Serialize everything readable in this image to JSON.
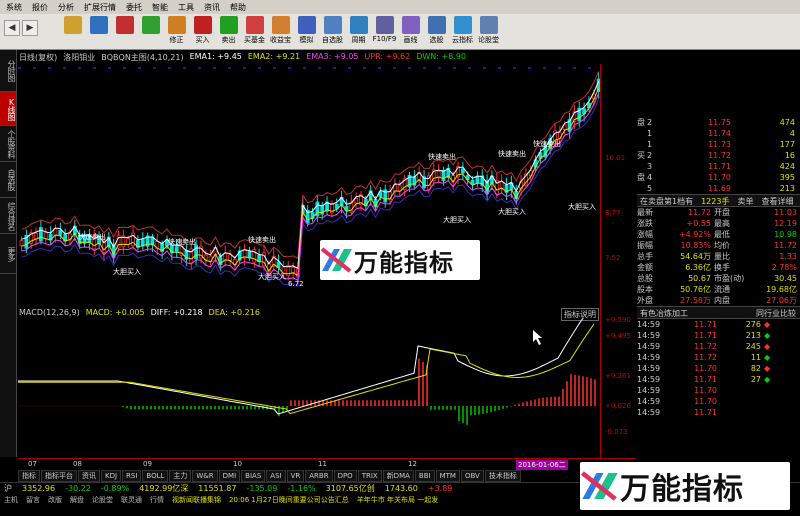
{
  "menu": [
    "系统",
    "报价",
    "分析",
    "扩展行情",
    "委托",
    "智能",
    "工具",
    "资讯",
    "帮助"
  ],
  "toolbar": [
    "",
    "",
    "",
    "",
    "修正",
    "买入",
    "卖出",
    "买基金",
    "收益宝",
    "模拟",
    "自选股",
    "周期",
    "F10/F9",
    "画线",
    "选股",
    "云指标",
    "论股堂"
  ],
  "left_tabs": [
    "分时图",
    "K线图",
    "个股资料",
    "自选股",
    "综合排名",
    "更多"
  ],
  "info": {
    "period": "日线(复权)",
    "stock": "洛阳钼业",
    "indicator": "BQBQN主图(4,10,21)",
    "ema1": "EMA1: +9.45",
    "ema2": "EMA2: +9.21",
    "ema3": "EMA3: +9.05",
    "upr": "UPR: +9.62",
    "dwn": "DWN: +8.90"
  },
  "macd": {
    "title": "MACD(12,26,9)",
    "macd": "MACD: +0.005",
    "diff": "DIFF: +0.218",
    "dea": "DEA: +0.216",
    "right": "指标说明"
  },
  "axis_right": [
    "10.01",
    "8.77",
    "7.52",
    "+0.590",
    "+0.495",
    "+0.261",
    "+0.026",
    "-0.073"
  ],
  "xaxis": [
    "07",
    "08",
    "09",
    "10",
    "11",
    "12",
    "2016-01-06二"
  ],
  "bottom_tabs": [
    "指标",
    "指标平台",
    "资讯",
    "KDJ",
    "RSI",
    "BOLL",
    "主力",
    "W&R",
    "DMI",
    "BIAS",
    "ASI",
    "VR",
    "ARBR",
    "DPO",
    "TRIX",
    "新DMA",
    "BBI",
    "MTM",
    "OBV",
    "技术指标"
  ],
  "annotations": [
    {
      "t": "快速卖出",
      "c": "wht"
    },
    {
      "t": "快速卖出",
      "c": "wht"
    },
    {
      "t": "快速卖出",
      "c": "wht"
    },
    {
      "t": "快速卖出",
      "c": "wht"
    },
    {
      "t": "快速卖出",
      "c": "wht"
    },
    {
      "t": "快速卖出",
      "c": "wht"
    },
    {
      "t": "大胆买入",
      "c": "wht"
    },
    {
      "t": "大胆买入",
      "c": "wht"
    },
    {
      "t": "大胆买入",
      "c": "wht"
    },
    {
      "t": "大胆买入",
      "c": "wht"
    },
    {
      "t": "大胆买入",
      "c": "wht"
    },
    {
      "t": "6.72",
      "c": "wht"
    }
  ],
  "orderbook": [
    {
      "l": "盘",
      "n": "2",
      "p": "11.75",
      "v": "474"
    },
    {
      "l": "",
      "n": "1",
      "p": "11.74",
      "v": "4"
    },
    {
      "l": "",
      "n": "1",
      "p": "11.73",
      "v": "177"
    },
    {
      "l": "买",
      "n": "2",
      "p": "11.72",
      "v": "16"
    },
    {
      "l": "",
      "n": "3",
      "p": "11.71",
      "v": "424"
    },
    {
      "l": "盘",
      "n": "4",
      "p": "11.70",
      "v": "395"
    },
    {
      "l": "",
      "n": "5",
      "p": "11.69",
      "v": "213"
    }
  ],
  "tabs_line": [
    "在卖盘第1档有",
    "1223手",
    "卖单",
    "查看详细"
  ],
  "quote": [
    {
      "a": "最新",
      "b": "11.72",
      "c": "开盘",
      "d": "11.03"
    },
    {
      "a": "涨跌",
      "b": "+0.55",
      "c": "最高",
      "d": "12.19"
    },
    {
      "a": "涨幅",
      "b": "+4.92%",
      "c": "最低",
      "d": "10.98"
    },
    {
      "a": "振幅",
      "b": "10.83%",
      "c": "均价",
      "d": "11.72"
    },
    {
      "a": "总手",
      "b": "54.64万",
      "c": "量比",
      "d": "1.33"
    },
    {
      "a": "金额",
      "b": "6.36亿",
      "c": "换手",
      "d": "2.78%"
    },
    {
      "a": "总股",
      "b": "50.67",
      "c": "市盈(动)",
      "d": "30.45"
    },
    {
      "a": "股本",
      "b": "50.76亿",
      "c": "流通",
      "d": "19.68亿"
    },
    {
      "a": "外盘",
      "b": "27.58万",
      "c": "内盘",
      "d": "27.06万"
    }
  ],
  "sect2": [
    "有色冶炼加工",
    "",
    "同行业比较"
  ],
  "ticks": [
    {
      "t": "14:59",
      "p": "11.71",
      "v": "276",
      "a": "◆"
    },
    {
      "t": "14:59",
      "p": "11.71",
      "v": "213",
      "a": "◆"
    },
    {
      "t": "14:59",
      "p": "11.72",
      "v": "245",
      "a": "◆"
    },
    {
      "t": "14:59",
      "p": "11.72",
      "v": "11",
      "a": "◆"
    },
    {
      "t": "14:59",
      "p": "11.70",
      "v": "82",
      "a": "◆"
    },
    {
      "t": "14:59",
      "p": "11.71",
      "v": "27",
      "a": "◆"
    },
    {
      "t": "14:59",
      "p": "11.70",
      "v": "",
      "a": ""
    },
    {
      "t": "14:59",
      "p": "11.70",
      "v": "",
      "a": ""
    },
    {
      "t": "14:59",
      "p": "11.71",
      "v": "",
      "a": ""
    }
  ],
  "status1": [
    "沪",
    "3352.96",
    "-30.22",
    "-0.89%",
    "4192.99亿深",
    "11551.87",
    "-135.09",
    "-1.16%",
    "3107.65亿创",
    "1743.60",
    "+3.89"
  ],
  "status2": [
    "主机",
    "留言",
    "改版",
    "解盘",
    "论股堂",
    "联灵通",
    "行情",
    "视新闻联播集锦",
    "20:06 1月27日晚间重要公司公告汇总",
    "羊年牛市 年关布局 一起发"
  ],
  "watermark": "万能指标",
  "chart_data": {
    "type": "candlestick",
    "axis_y_ticks": [
      10.01,
      8.77,
      7.52
    ],
    "macd_y_ticks": [
      0.59,
      0.495,
      0.261,
      0.026,
      -0.073
    ],
    "x_ticks": [
      "07",
      "08",
      "09",
      "10",
      "11",
      "12"
    ]
  },
  "colors": {
    "up": "#ff3030",
    "down": "#00e0e0",
    "grid": "#a00000",
    "bg": "#000000"
  }
}
